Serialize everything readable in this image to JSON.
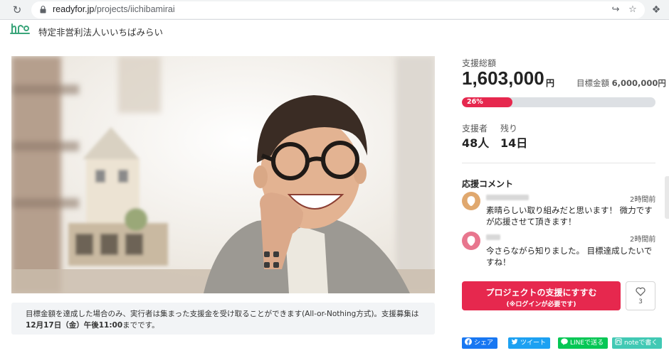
{
  "browser": {
    "url_host": "readyfor.jp",
    "url_path": "/projects/iichibamirai"
  },
  "org": {
    "name": "特定非営利法人いいちばみらい"
  },
  "notice": {
    "text_part1": "目標金額を達成した場合のみ、実行者は集まった支援金を受け取ることができます(All-or-Nothing方式)。支援募集は",
    "text_bold1": "12月17日（金）午後11:00",
    "text_part2": "までです。"
  },
  "stats": {
    "total_label": "支援総額",
    "total_amount": "1,603,000",
    "total_unit": "円",
    "goal_label": "目標金額",
    "goal_amount": "6,000,000円",
    "progress_percent": 26,
    "progress_label": "26%",
    "supporters_label": "支援者",
    "supporters_value": "48人",
    "remaining_label": "残り",
    "remaining_value": "14日"
  },
  "comments": {
    "title": "応援コメント",
    "items": [
      {
        "time": "2時間前",
        "text": "素晴らしい取り組みだと思います！ 微力ですが応援させて頂きます！",
        "avatar_color": "#e0a86e"
      },
      {
        "time": "2時間前",
        "text": "今さらながら知りました。 目標達成したいですね！",
        "avatar_color": "#e8768e"
      }
    ]
  },
  "actions": {
    "support_label": "プロジェクトの支援にすすむ",
    "support_sub": "(※ログインが必要です)",
    "like_count": "3"
  },
  "share": {
    "facebook": "シェア",
    "twitter": "ツイート",
    "line": "LINEで送る",
    "note": "noteで書く"
  },
  "colors": {
    "accent": "#e6284e",
    "facebook": "#1877f2",
    "twitter": "#1da1f2",
    "line": "#06c755",
    "note": "#41c9b4"
  }
}
